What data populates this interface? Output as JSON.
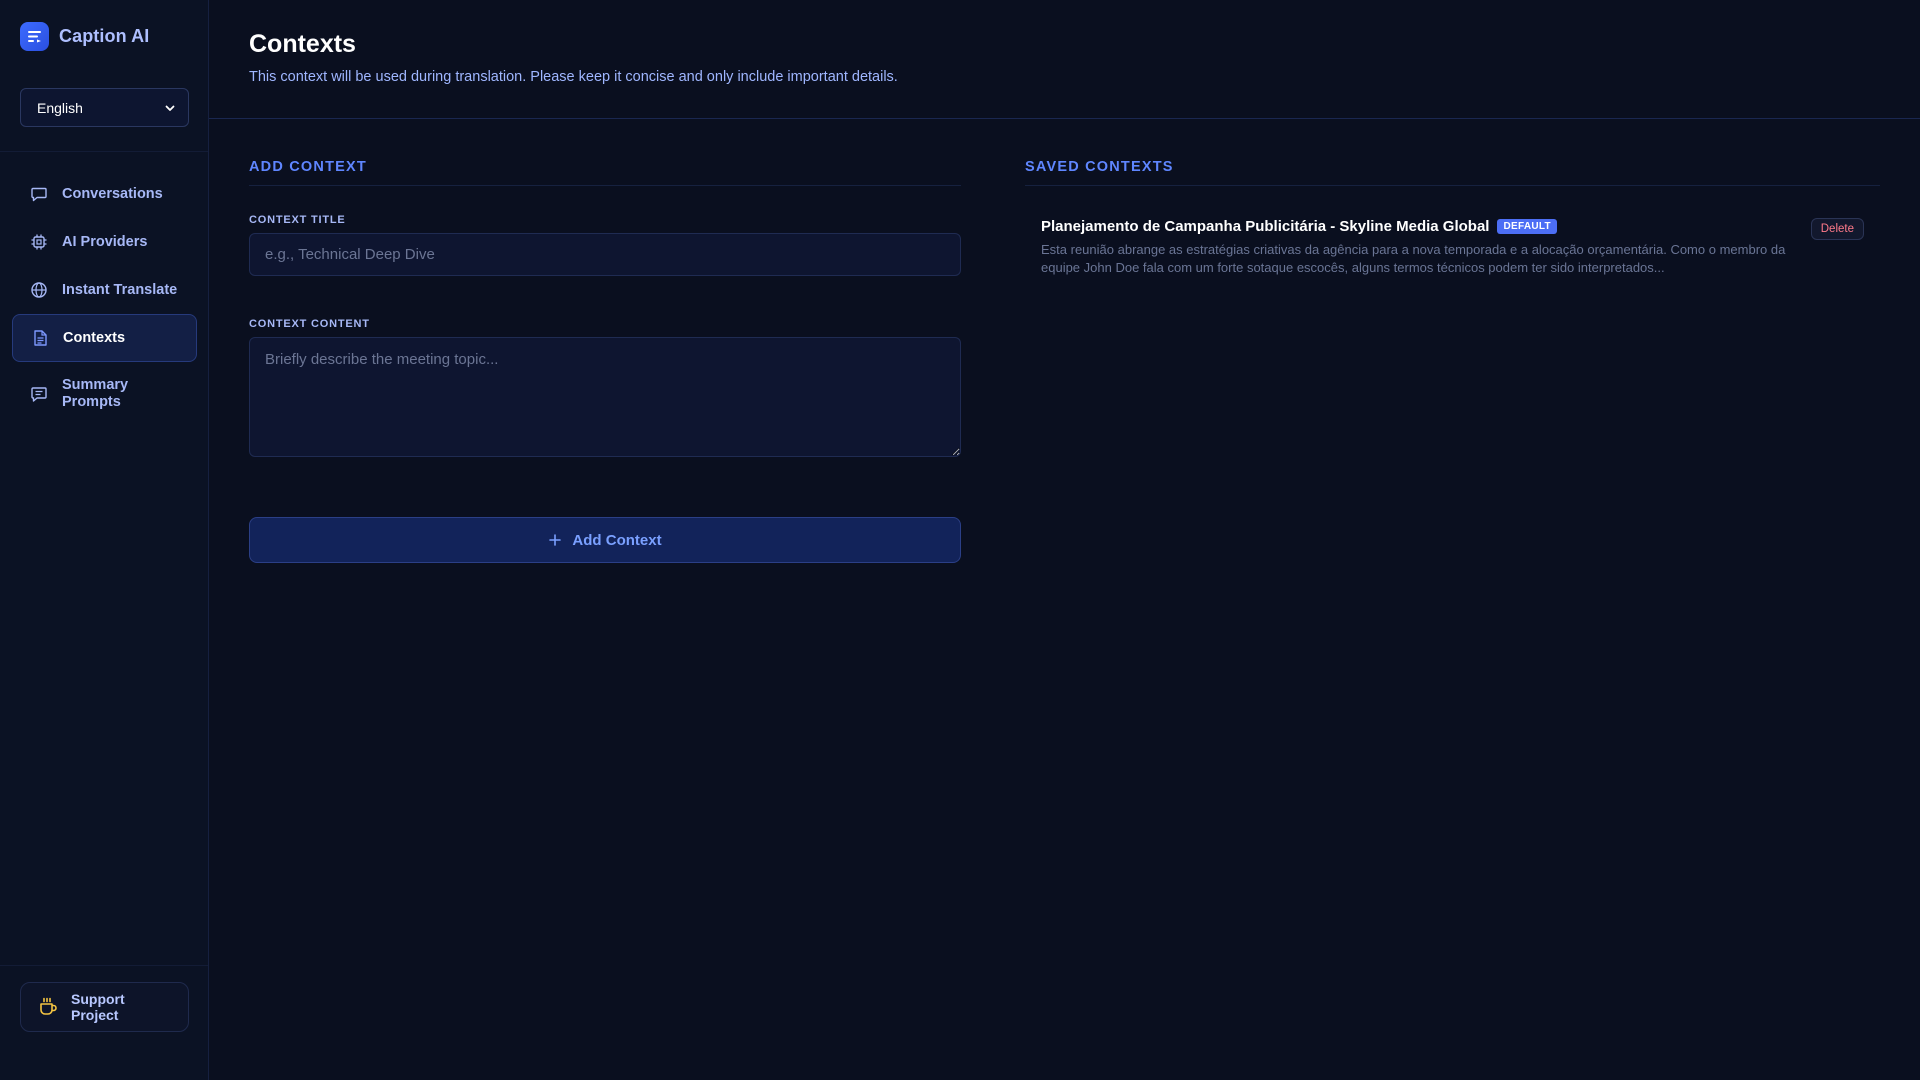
{
  "app": {
    "name": "Caption AI",
    "logo_icon": "caption-logo-icon"
  },
  "language_select": {
    "selected": "English"
  },
  "sidebar": {
    "items": [
      {
        "label": "Conversations",
        "icon": "chat-bubble-icon",
        "active": false
      },
      {
        "label": "AI Providers",
        "icon": "chip-icon",
        "active": false
      },
      {
        "label": "Instant Translate",
        "icon": "globe-icon",
        "active": false
      },
      {
        "label": "Contexts",
        "icon": "document-icon",
        "active": true
      },
      {
        "label": "Summary Prompts",
        "icon": "message-lines-icon",
        "active": false
      }
    ],
    "support_label": "Support Project",
    "support_icon": "coffee-cup-icon"
  },
  "page": {
    "title": "Contexts",
    "subtitle": "This context will be used during translation. Please keep it concise and only include important details."
  },
  "add_context": {
    "section_title": "ADD CONTEXT",
    "title_label": "CONTEXT TITLE",
    "title_placeholder": "e.g., Technical Deep Dive",
    "title_value": "",
    "content_label": "CONTEXT CONTENT",
    "content_placeholder": "Briefly describe the meeting topic...",
    "content_value": "",
    "button_label": "Add Context"
  },
  "saved_contexts": {
    "section_title": "SAVED CONTEXTS",
    "items": [
      {
        "title": "Planejamento de Campanha Publicitária - Skyline Media Global",
        "badge": "DEFAULT",
        "description": "Esta reunião abrange as estratégias criativas da agência para a nova temporada e a alocação orçamentária. Como o membro da equipe John Doe fala com um forte sotaque escocês, alguns termos técnicos podem ter sido interpretados...",
        "delete_label": "Delete"
      }
    ]
  },
  "colors": {
    "background": "#0a0f1f",
    "sidebar": "#0b1224",
    "accent": "#5f86ff",
    "badge": "#4c6ef5",
    "danger": "#ff7a8a"
  }
}
